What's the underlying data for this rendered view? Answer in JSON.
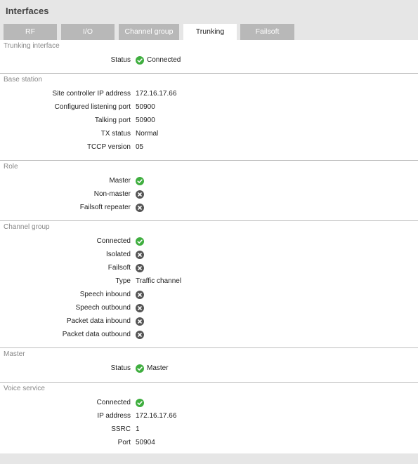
{
  "header": {
    "title": "Interfaces"
  },
  "tabs": [
    {
      "label": "RF",
      "active": false
    },
    {
      "label": "I/O",
      "active": false
    },
    {
      "label": "Channel group",
      "active": false
    },
    {
      "label": "Trunking",
      "active": true
    },
    {
      "label": "Failsoft",
      "active": false
    }
  ],
  "trunking_interface": {
    "title": "Trunking interface",
    "status_label": "Status",
    "status_icon": "check-icon",
    "status_value": "Connected"
  },
  "base_station": {
    "title": "Base station",
    "site_controller_ip_label": "Site controller IP address",
    "site_controller_ip_value": "172.16.17.66",
    "listening_port_label": "Configured listening port",
    "listening_port_value": "50900",
    "talking_port_label": "Talking port",
    "talking_port_value": "50900",
    "tx_status_label": "TX status",
    "tx_status_value": "Normal",
    "tccp_version_label": "TCCP version",
    "tccp_version_value": "05"
  },
  "role": {
    "title": "Role",
    "master_label": "Master",
    "master_icon": "check-icon",
    "non_master_label": "Non-master",
    "non_master_icon": "cross-icon",
    "failsoft_repeater_label": "Failsoft repeater",
    "failsoft_repeater_icon": "cross-icon"
  },
  "channel_group": {
    "title": "Channel group",
    "connected_label": "Connected",
    "connected_icon": "check-icon",
    "isolated_label": "Isolated",
    "isolated_icon": "cross-icon",
    "failsoft_label": "Failsoft",
    "failsoft_icon": "cross-icon",
    "type_label": "Type",
    "type_value": "Traffic channel",
    "speech_inbound_label": "Speech inbound",
    "speech_inbound_icon": "cross-icon",
    "speech_outbound_label": "Speech outbound",
    "speech_outbound_icon": "cross-icon",
    "packet_data_inbound_label": "Packet data inbound",
    "packet_data_inbound_icon": "cross-icon",
    "packet_data_outbound_label": "Packet data outbound",
    "packet_data_outbound_icon": "cross-icon"
  },
  "master": {
    "title": "Master",
    "status_label": "Status",
    "status_icon": "check-icon",
    "status_value": "Master"
  },
  "voice_service": {
    "title": "Voice service",
    "connected_label": "Connected",
    "connected_icon": "check-icon",
    "ip_address_label": "IP address",
    "ip_address_value": "172.16.17.66",
    "ssrc_label": "SSRC",
    "ssrc_value": "1",
    "port_label": "Port",
    "port_value": "50904"
  },
  "colors": {
    "check": "#3fae3f",
    "cross": "#555555",
    "tab_inactive": "#b8b8b8",
    "header_bg": "#e6e6e6"
  }
}
